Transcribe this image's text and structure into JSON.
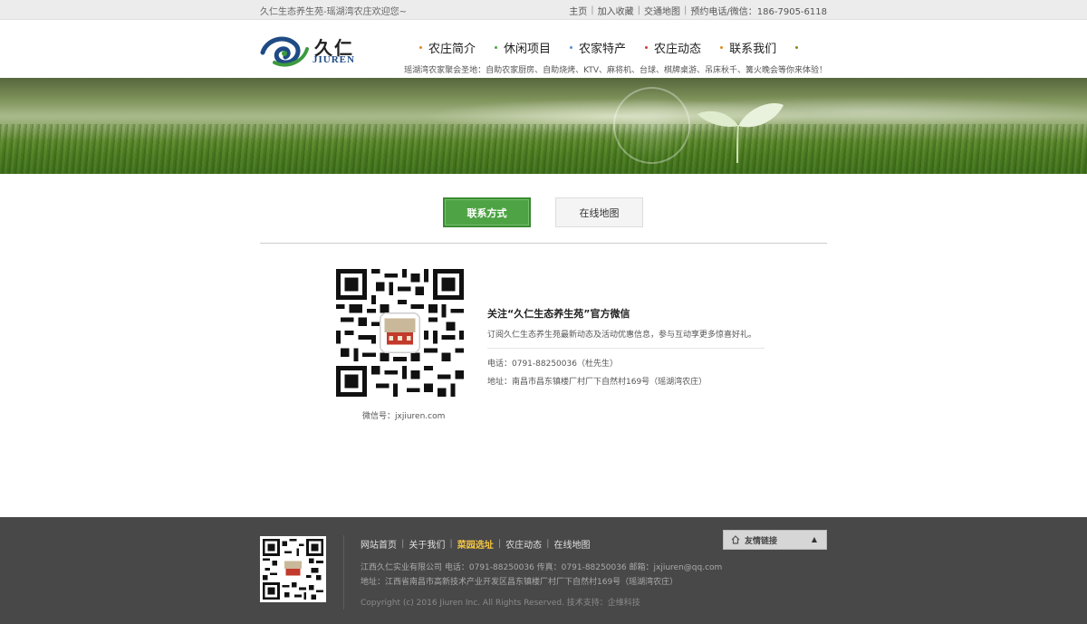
{
  "topbar": {
    "welcome": "久仁生态养生苑-瑶湖湾农庄欢迎您~",
    "links": [
      "主页",
      "加入收藏",
      "交通地图",
      "预约电话/微信：186-7905-6118"
    ]
  },
  "logo": {
    "text": "久仁",
    "subtext": "JIUREN"
  },
  "nav": {
    "items": [
      {
        "label": "农庄简介",
        "dot": "#e08a1e"
      },
      {
        "label": "休闲项目",
        "dot": "#4ea444"
      },
      {
        "label": "农家特产",
        "dot": "#5b8fd0"
      },
      {
        "label": "农庄动态",
        "dot": "#d23b3b"
      },
      {
        "label": "联系我们",
        "dot": "#e08a1e"
      }
    ],
    "end_dot": "#8a8a1e"
  },
  "tagline": "瑶湖湾农家聚会圣地：自助农家厨房、自助烧烤、KTV、麻将机、台球、棋牌桌游、吊床秋千、篝火晚会等你来体验！",
  "tabs": {
    "active": "联系方式",
    "other": "在线地图"
  },
  "contact": {
    "wechat_id": "微信号：jxjiuren.com",
    "title": "关注“久仁生态养生苑”官方微信",
    "desc": "订阅久仁生态养生苑最新动态及活动优惠信息，参与互动享更多惊喜好礼。",
    "phone": "电话：0791-88250036（杜先生）",
    "address": "地址：南昌市昌东镇楼厂村厂下自然村169号（瑶湖湾农庄）"
  },
  "footer": {
    "links": [
      "网站首页",
      "关于我们",
      "菜园选址",
      "农庄动态",
      "在线地图"
    ],
    "highlight_index": 2,
    "company_line": "江西久仁实业有限公司 电话：0791-88250036 传真：0791-88250036 邮箱：jxjiuren@qq.com",
    "address_line": "地址：江西省南昌市高新技术产业开发区昌东镇楼厂村厂下自然村169号（瑶湖湾农庄）",
    "copyright": "Copyright (c) 2016 Jiuren Inc. All Rights Reserved.   技术支持：企维科技",
    "friend_links": "友情链接"
  },
  "icons": {
    "home": "home-icon",
    "caret": "caret-up-icon"
  },
  "colors": {
    "green": "#4ea444",
    "footer_bg": "#484848",
    "highlight": "#f4c542"
  }
}
